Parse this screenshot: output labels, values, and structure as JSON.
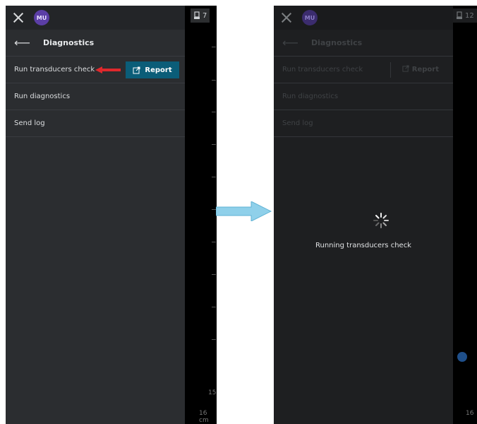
{
  "left": {
    "probe_badge": "7",
    "avatar": "MU",
    "header_title": "Diagnostics",
    "menu": [
      {
        "label": "Run transducers check"
      },
      {
        "label": "Run diagnostics"
      },
      {
        "label": "Send log"
      }
    ],
    "report_label": "Report",
    "depth_label": "16 cm",
    "depth_partial": "15"
  },
  "right": {
    "probe_badge": "12",
    "avatar": "MU",
    "header_title": "Diagnostics",
    "menu": [
      {
        "label": "Run transducers check"
      },
      {
        "label": "Run diagnostics"
      },
      {
        "label": "Send log"
      }
    ],
    "report_label": "Report",
    "status_text": "Running transducers check",
    "depth_label": "16"
  },
  "colors": {
    "drawer_bg": "#2b2d30",
    "topbar_bg": "#232528",
    "accent_button": "#0b5d78",
    "annotation_red": "#e0282c",
    "transition_arrow": "#8fd0ea",
    "avatar_purple": "#5b3ea6"
  },
  "icons": [
    "close-icon",
    "back-arrow-icon",
    "external-link-icon",
    "spinner-icon",
    "probe-icon",
    "red-annotation-arrow",
    "transition-arrow"
  ]
}
